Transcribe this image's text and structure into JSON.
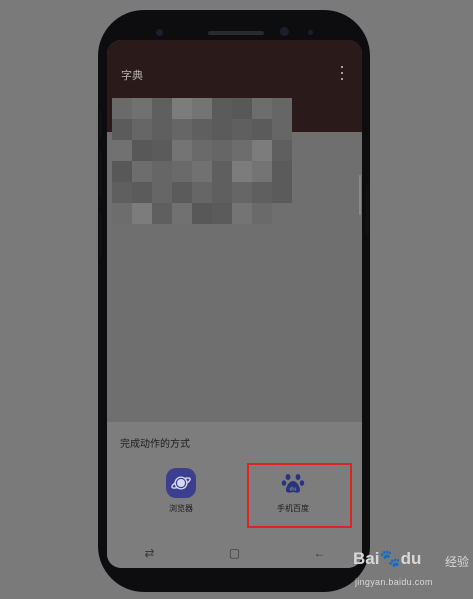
{
  "app": {
    "title": "字典"
  },
  "sheet": {
    "title": "完成动作的方式",
    "options": [
      {
        "label": "浏览器",
        "icon": "browser-planet-icon",
        "color": "#3c3f8f"
      },
      {
        "label": "手机百度",
        "icon": "baidu-paw-icon",
        "color": "#29327e"
      }
    ]
  },
  "nav": {
    "recent_icon": "⇄",
    "home_icon": "▢",
    "back_icon": "←"
  },
  "watermark": {
    "brand": "Bai",
    "brand_tail": "du",
    "sub": "经验",
    "url": "jingyan.baidu.com"
  },
  "colors": {
    "highlight": "#e02222",
    "appbar": "#2a1a1a"
  }
}
